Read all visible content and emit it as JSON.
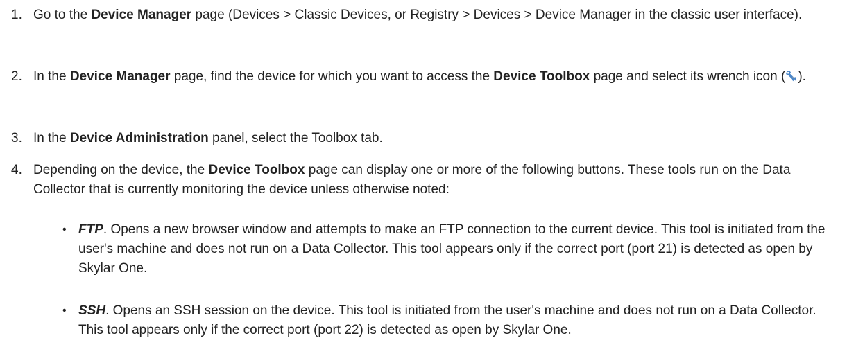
{
  "steps": [
    {
      "num": "1.",
      "t1": "Go to the ",
      "b1": "Device Manager",
      "t2": " page (Devices > Classic Devices, or Registry > Devices > Device Manager in the classic user interface)."
    },
    {
      "num": "2.",
      "t1": "In the ",
      "b1": "Device Manager",
      "t2": " page, find the device for which you want to access the ",
      "b2": "Device Toolbox",
      "t3": " page and select its wrench icon (",
      "icon": "wrench-icon",
      "t4": ")."
    },
    {
      "num": "3.",
      "t1": "In the ",
      "b1": "Device Administration",
      "t2": " panel, select the Toolbox tab."
    },
    {
      "num": "4.",
      "t1": "Depending on the device, the ",
      "b1": "Device Toolbox",
      "t2": " page can display one or more of the following buttons. These tools run on the Data Collector that is currently monitoring the device unless otherwise noted:"
    }
  ],
  "bullets": [
    {
      "dot": "•",
      "term": "FTP",
      "desc": ". Opens a new browser window and attempts to make an FTP connection to the current device. This tool is initiated from the user's machine and does not run on a Data Collector. This tool appears only if the correct port (port 21) is detected as open by Skylar One."
    },
    {
      "dot": "•",
      "term": "SSH",
      "desc": ". Opens an SSH session on the device. This tool is initiated from the user's machine and does not run on a Data Collector. This tool appears only if the correct port (port 22) is detected as open by Skylar One."
    }
  ],
  "colors": {
    "text": "#222222",
    "wrench_blue": "#4a86c8",
    "wrench_gray": "#8a9aaa"
  }
}
